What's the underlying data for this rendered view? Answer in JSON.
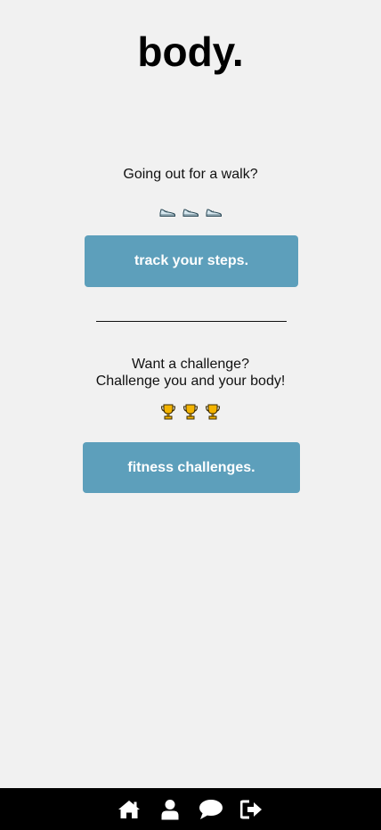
{
  "header": {
    "title": "body."
  },
  "walk_section": {
    "prompt": "Going out for a walk?",
    "icons": [
      "running-shoe-icon",
      "running-shoe-icon",
      "running-shoe-icon"
    ],
    "button_label": "track your steps."
  },
  "challenge_section": {
    "prompt_line1": "Want a challenge?",
    "prompt_line2": "Challenge you and your body!",
    "icons": [
      "trophy-icon",
      "trophy-icon",
      "trophy-icon"
    ],
    "button_label": "fitness challenges."
  },
  "bottom_nav": {
    "items": [
      {
        "icon": "home-icon"
      },
      {
        "icon": "user-icon"
      },
      {
        "icon": "chat-icon"
      },
      {
        "icon": "sign-out-icon"
      }
    ]
  },
  "colors": {
    "background": "#f1f1f1",
    "button": "#5d9fbb",
    "button_text": "#ffffff",
    "nav_bar": "#000000",
    "nav_icon": "#ffffff"
  }
}
